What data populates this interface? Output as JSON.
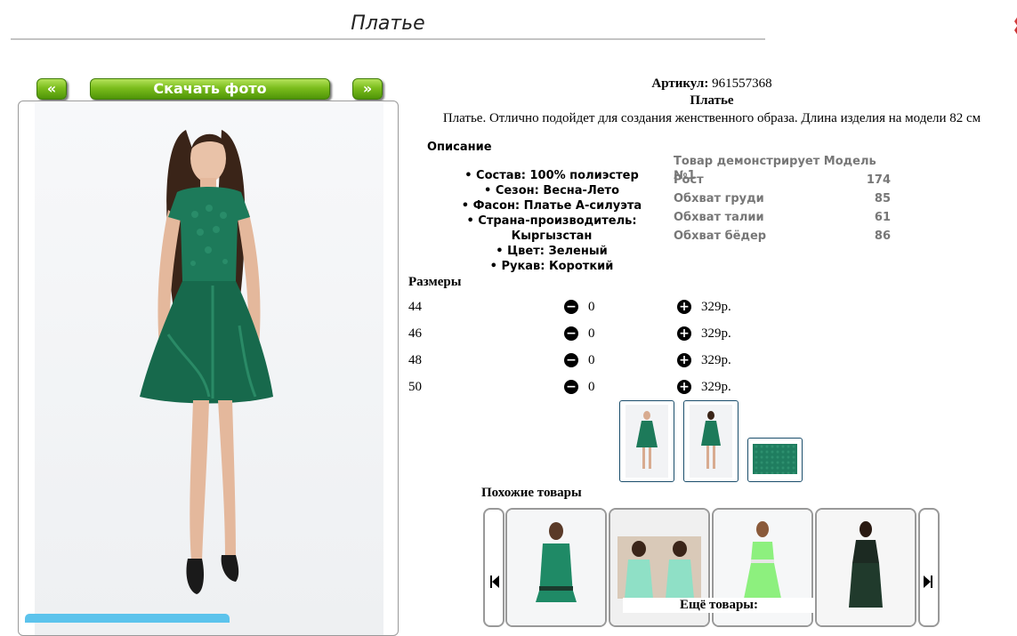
{
  "header": {
    "title": "Платье"
  },
  "gallery": {
    "prev_label": "«",
    "download_label": "Скачать фото",
    "next_label": "»"
  },
  "product": {
    "article_label": "Артикул:",
    "article_value": "961557368",
    "name": "Платье",
    "description": "Платье. Отлично подойдет для создания женственного образа. Длина изделия на модели 82 см"
  },
  "details": {
    "heading": "Описание",
    "attributes": [
      "Состав: 100% полиэстер",
      "Сезон: Весна-Лето",
      "Фасон: Платье А-силуэта",
      "Страна-производитель: Кыргызстан",
      "Цвет: Зеленый",
      "Рукав: Короткий"
    ]
  },
  "model": {
    "title": "Товар демонстрирует Модель №1",
    "rows": [
      {
        "label": "Рост",
        "value": "174"
      },
      {
        "label": "Обхват груди",
        "value": "85"
      },
      {
        "label": "Обхват талии",
        "value": "61"
      },
      {
        "label": "Обхват бёдер",
        "value": "86"
      }
    ]
  },
  "sizes": {
    "heading": "Размеры",
    "rows": [
      {
        "size": "44",
        "qty": "0",
        "price": "329р."
      },
      {
        "size": "46",
        "qty": "0",
        "price": "329р."
      },
      {
        "size": "48",
        "qty": "0",
        "price": "329р."
      },
      {
        "size": "50",
        "qty": "0",
        "price": "329р."
      }
    ]
  },
  "similar": {
    "heading": "Похожие товары"
  },
  "more": {
    "heading": "Ещё товары:"
  },
  "colors": {
    "dress_green": "#1d7a5a",
    "button_green": "#7bbd1c",
    "model_text": "#777777"
  },
  "icons": [
    "minus-circle-icon",
    "plus-circle-icon",
    "skip-prev-icon",
    "skip-next-icon"
  ]
}
